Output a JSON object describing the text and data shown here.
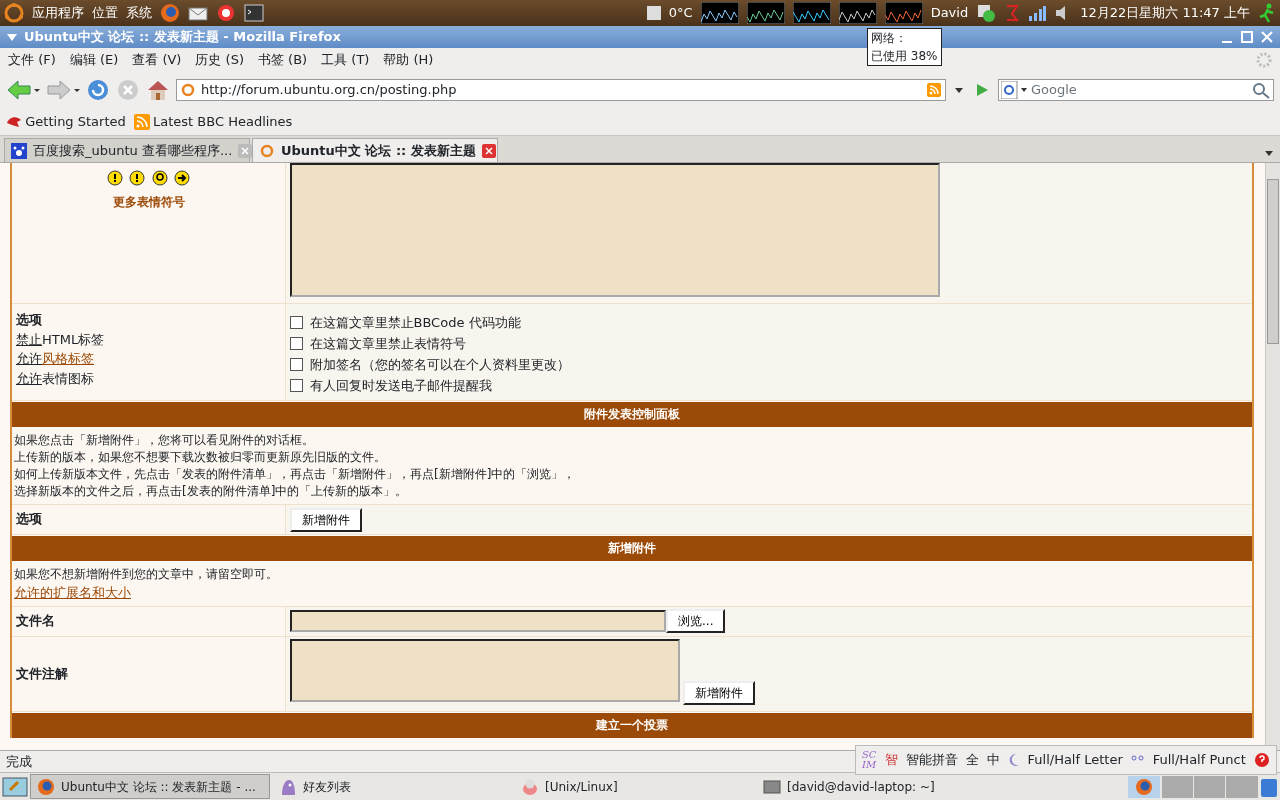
{
  "top_panel": {
    "menus": [
      "应用程序",
      "位置",
      "系统"
    ],
    "temperature": "0°C",
    "user": "David",
    "clock": "12月22日星期六 11:47 上午"
  },
  "tooltip": {
    "lines": [
      "网络：",
      "已使用 38%"
    ]
  },
  "window": {
    "title": "Ubuntu中文 论坛 :: 发表新主题 - Mozilla Firefox"
  },
  "menu_bar": [
    "文件 (F)",
    "编辑 (E)",
    "查看 (V)",
    "历史 (S)",
    "书签 (B)",
    "工具 (T)",
    "帮助 (H)"
  ],
  "address_bar": {
    "value": "http://forum.ubuntu.org.cn/posting.php"
  },
  "search_box": {
    "placeholder": "Google"
  },
  "bookmarks": [
    "Getting Started",
    "Latest BBC Headlines"
  ],
  "tabs": [
    {
      "label": "百度搜索_ubuntu 查看哪些程序...",
      "selected": false
    },
    {
      "label": "Ubuntu中文 论坛 :: 发表新主题",
      "selected": true
    }
  ],
  "form": {
    "more_smilies": "更多表情符号",
    "options_title": "选项",
    "options_rules": [
      {
        "state": "禁止",
        "label": "HTML标签",
        "label_link": false
      },
      {
        "state": "允许",
        "label": "风格标签",
        "label_link": true
      },
      {
        "state": "允许",
        "label": "表情图标",
        "label_link": false
      }
    ],
    "checkboxes": [
      {
        "label": "在这篇文章里禁止BBCode 代码功能",
        "checked": false
      },
      {
        "label": "在这篇文章里禁止表情符号",
        "checked": false
      },
      {
        "label": "附加签名（您的签名可以在个人资料里更改）",
        "checked": false
      },
      {
        "label": "有人回复时发送电子邮件提醒我",
        "checked": false
      }
    ],
    "attach_header": "附件发表控制面板",
    "attach_help": [
      "如果您点击「新增附件」，您将可以看见附件的对话框。",
      "上传新的版本，如果您不想要下载次数被归零而更新原先旧版的文件。",
      "如何上传新版本文件，先点击「发表的附件清单」，再点击「新增附件」，再点[新增附件]中的「浏览」，",
      "选择新版本的文件之后，再点击[发表的附件清单]中的「上传新的版本」。"
    ],
    "attach_option_label": "选项",
    "attach_option_button": "新增附件",
    "add_header": "新增附件",
    "add_help": "如果您不想新增附件到您的文章中，请留空即可。",
    "add_link": "允许的扩展名和大小",
    "filename_label": "文件名",
    "browse_button": "浏览...",
    "comment_label": "文件注解",
    "add_button": "新增附件",
    "poll_header": "建立一个投票"
  },
  "status_bar": {
    "text": "完成"
  },
  "ime_bar": {
    "logo": [
      "SC",
      "IM"
    ],
    "mark": "智",
    "items": [
      "智能拼音",
      "全",
      "中",
      "Full/Half Letter",
      "Full/Half Punct"
    ]
  },
  "taskbar": [
    {
      "label": "Ubuntu中文 论坛 :: 发表新主题 - ...",
      "selected": true,
      "kind": "firefox"
    },
    {
      "label": "好友列表",
      "selected": false,
      "kind": "pidgin"
    },
    {
      "label": "[Unix/Linux]",
      "selected": false,
      "kind": "qq"
    },
    {
      "label": "[david@david-laptop: ~]",
      "selected": false,
      "kind": "terminal"
    }
  ]
}
